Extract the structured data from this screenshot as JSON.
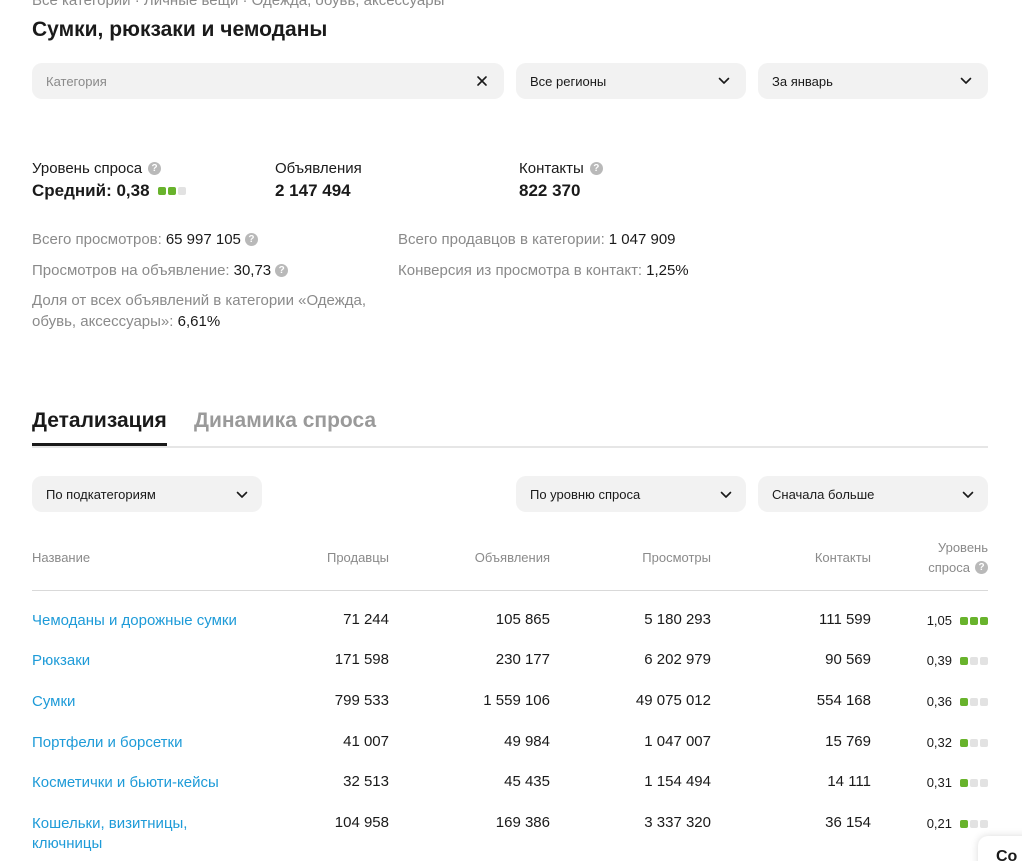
{
  "breadcrumb": "Все категории · Личные вещи · Одежда, обувь, аксессуары",
  "page_title": "Сумки, рюкзаки и чемоданы",
  "filters": {
    "category_placeholder": "Категория",
    "region": "Все регионы",
    "period": "За январь"
  },
  "metrics": {
    "demand_label": "Уровень спроса",
    "demand_value": "Средний: 0,38",
    "demand_level": 2,
    "ads_label": "Объявления",
    "ads_value": "2 147 494",
    "contacts_label": "Контакты",
    "contacts_value": "822 370"
  },
  "stats": {
    "total_views_label": "Всего просмотров:",
    "total_views_value": "65 997 105",
    "views_per_ad_label": "Просмотров на объявление:",
    "views_per_ad_value": "30,73",
    "share_label": "Доля от всех объявлений в категории «Одежда, обувь, аксессуары»:",
    "share_value": "6,61%",
    "sellers_label": "Всего продавцов в категории:",
    "sellers_value": "1 047 909",
    "conversion_label": "Конверсия из просмотра в контакт:",
    "conversion_value": "1,25%"
  },
  "tabs": [
    {
      "label": "Детализация",
      "active": true
    },
    {
      "label": "Динамика спроса",
      "active": false
    }
  ],
  "table_controls": {
    "group_by": "По подкатегориям",
    "sort_by": "По уровню спроса",
    "order": "Сначала больше"
  },
  "table": {
    "headers": {
      "name": "Название",
      "sellers": "Продавцы",
      "ads": "Объявления",
      "views": "Просмотры",
      "contacts": "Контакты",
      "demand_1": "Уровень",
      "demand_2": "спроса"
    },
    "rows": [
      {
        "name": "Чемоданы и дорожные сумки",
        "sellers": "71 244",
        "ads": "105 865",
        "views": "5 180 293",
        "contacts": "111 599",
        "demand": "1,05",
        "level": 3
      },
      {
        "name": "Рюкзаки",
        "sellers": "171 598",
        "ads": "230 177",
        "views": "6 202 979",
        "contacts": "90 569",
        "demand": "0,39",
        "level": 1
      },
      {
        "name": "Сумки",
        "sellers": "799 533",
        "ads": "1 559 106",
        "views": "49 075 012",
        "contacts": "554 168",
        "demand": "0,36",
        "level": 1
      },
      {
        "name": "Портфели и борсетки",
        "sellers": "41 007",
        "ads": "49 984",
        "views": "1 047 007",
        "contacts": "15 769",
        "demand": "0,32",
        "level": 1
      },
      {
        "name": "Косметички и бьюти-кейсы",
        "sellers": "32 513",
        "ads": "45 435",
        "views": "1 154 494",
        "contacts": "14 111",
        "demand": "0,31",
        "level": 1
      },
      {
        "name": "Кошельки, визитницы, ключницы",
        "sellers": "104 958",
        "ads": "169 386",
        "views": "3 337 320",
        "contacts": "36 154",
        "demand": "0,21",
        "level": 1
      }
    ]
  },
  "corner_button": "Со"
}
